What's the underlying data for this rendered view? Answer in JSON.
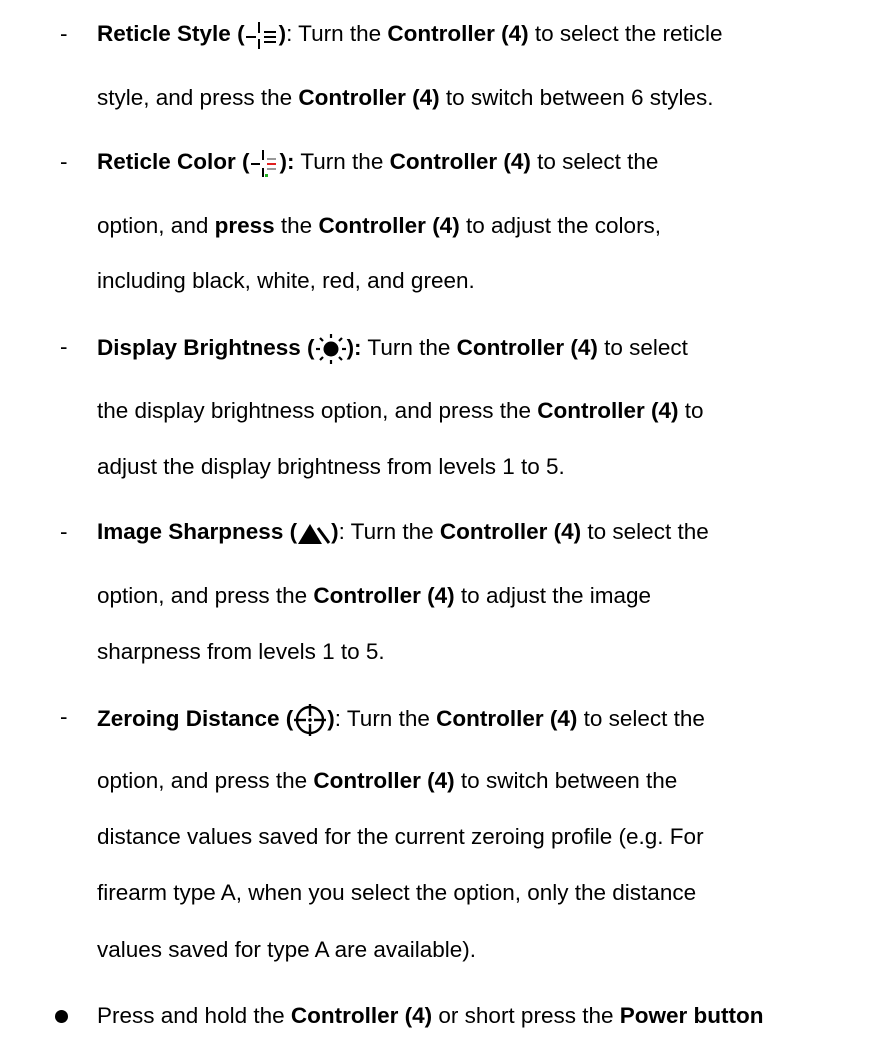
{
  "items": [
    {
      "title": "Reticle Style (",
      "title_close": ")",
      "icon": "reticle-style-icon",
      "line1_a": ": Turn the ",
      "line1_b": "Controller (4)",
      "line1_c": " to select the reticle",
      "line2_a": "style, and press the ",
      "line2_b": "Controller (4)",
      "line2_c": " to switch between 6 styles."
    },
    {
      "title": "Reticle Color (",
      "title_close": "):",
      "icon": "reticle-color-icon",
      "line1_a": " Turn the ",
      "line1_b": "Controller (4)",
      "line1_c": " to select the",
      "line2_a": "option, and ",
      "line2_b": "press",
      "line2_c": " the ",
      "line2_d": "Controller (4)",
      "line2_e": " to adjust the colors,",
      "line3": "including black, white, red, and green."
    },
    {
      "title": "Display Brightness (",
      "title_close": "):",
      "icon": "brightness-sun-icon",
      "line1_a": " Turn the ",
      "line1_b": "Controller (4)",
      "line1_c": " to select",
      "line2_a": "the display brightness option, and press the ",
      "line2_b": "Controller (4)",
      "line2_c": " to",
      "line3": "adjust the display brightness from levels 1 to 5."
    },
    {
      "title": "Image Sharpness (",
      "title_close": ")",
      "icon": "sharpness-mountain-icon",
      "line1_a": ": Turn the ",
      "line1_b": "Controller (4)",
      "line1_c": " to select the",
      "line2_a": "option, and press the ",
      "line2_b": "Controller (4)",
      "line2_c": " to adjust the image",
      "line3": "sharpness from levels 1 to 5."
    },
    {
      "title": "Zeroing Distance (",
      "title_close": ")",
      "icon": "zeroing-crosshair-icon",
      "line1_a": ": Turn the ",
      "line1_b": "Controller (4)",
      "line1_c": " to select the",
      "line2_a": "option, and press the ",
      "line2_b": "Controller (4)",
      "line2_c": " to switch between the",
      "line3": "distance values saved for the current zeroing profile (e.g. For",
      "line4": "firearm type A, when you select the option, only the distance",
      "line5": "values saved for type A are available)."
    }
  ],
  "final_bullet": {
    "text_a": "Press and hold the ",
    "text_b": "Controller (4)",
    "text_c": " or short press the ",
    "text_d": "Power button"
  },
  "dash_char": "-",
  "colors": {
    "text": "#000000",
    "reticle_red": "#e02020",
    "reticle_green": "#20b020"
  }
}
